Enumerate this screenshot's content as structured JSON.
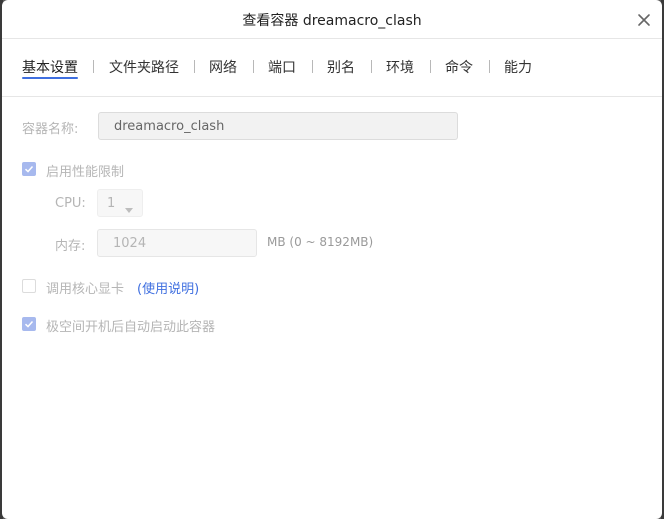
{
  "dialog": {
    "title": "查看容器 dreamacro_clash",
    "close_icon": "close-icon"
  },
  "tabs": [
    {
      "label": "基本设置",
      "active": true
    },
    {
      "label": "文件夹路径"
    },
    {
      "label": "网络"
    },
    {
      "label": "端口"
    },
    {
      "label": "别名"
    },
    {
      "label": "环境"
    },
    {
      "label": "命令"
    },
    {
      "label": "能力"
    }
  ],
  "form": {
    "container_name_label": "容器名称:",
    "container_name_value": "dreamacro_clash",
    "perf_limit_label": "启用性能限制",
    "perf_limit_checked": true,
    "cpu_label": "CPU:",
    "cpu_value": "1",
    "memory_label": "内存:",
    "memory_value": "1024",
    "memory_hint": "MB (0 ~ 8192MB)",
    "gpu_label": "调用核心显卡",
    "gpu_checked": false,
    "gpu_help_link": "(使用说明)",
    "autostart_label": "极空间开机后自动启动此容器",
    "autostart_checked": true
  },
  "colors": {
    "accent": "#3f6fe0",
    "checkbox_checked": "#a7b9ee",
    "disabled_text": "#b5b5b5"
  }
}
